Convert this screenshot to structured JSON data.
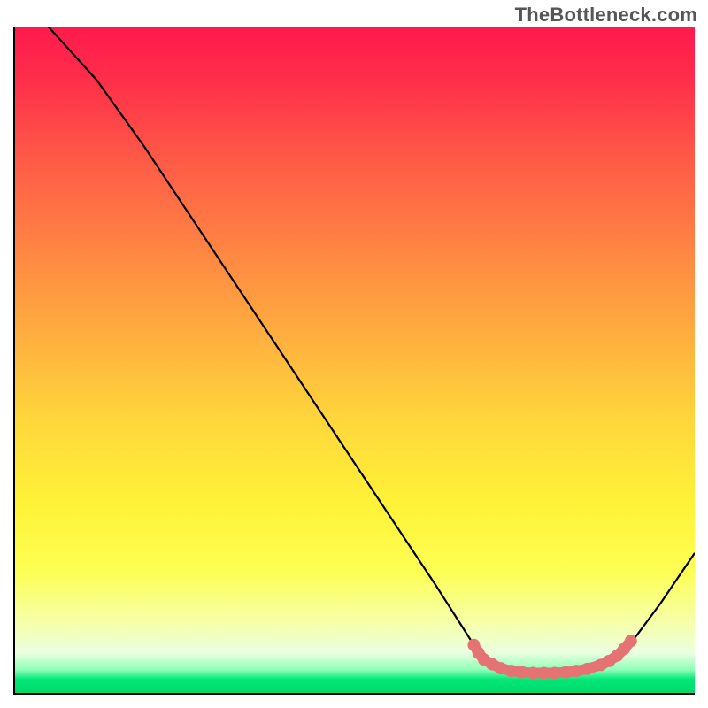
{
  "watermark": "TheBottleneck.com",
  "chart_data": {
    "type": "line",
    "title": "",
    "xlabel": "",
    "ylabel": "",
    "xlim": [
      0,
      100
    ],
    "ylim": [
      0,
      100
    ],
    "curve": [
      {
        "x": 4,
        "y": 101
      },
      {
        "x": 12,
        "y": 92
      },
      {
        "x": 19,
        "y": 82
      },
      {
        "x": 62,
        "y": 16
      },
      {
        "x": 67,
        "y": 8
      },
      {
        "x": 70,
        "y": 4.5
      },
      {
        "x": 73,
        "y": 3.3
      },
      {
        "x": 76,
        "y": 3.0
      },
      {
        "x": 79,
        "y": 3.0
      },
      {
        "x": 82,
        "y": 3.2
      },
      {
        "x": 85,
        "y": 3.8
      },
      {
        "x": 88,
        "y": 5.2
      },
      {
        "x": 91,
        "y": 8.0
      },
      {
        "x": 95,
        "y": 13.5
      },
      {
        "x": 100,
        "y": 21
      }
    ],
    "highlight_points": [
      {
        "x": 67.5,
        "y": 7.2
      },
      {
        "x": 68.2,
        "y": 6.0
      },
      {
        "x": 69.0,
        "y": 5.0
      },
      {
        "x": 70.2,
        "y": 4.3
      },
      {
        "x": 71.5,
        "y": 3.7
      },
      {
        "x": 73.0,
        "y": 3.3
      },
      {
        "x": 74.6,
        "y": 3.1
      },
      {
        "x": 76.2,
        "y": 3.0
      },
      {
        "x": 77.8,
        "y": 3.0
      },
      {
        "x": 79.4,
        "y": 3.0
      },
      {
        "x": 81.0,
        "y": 3.1
      },
      {
        "x": 82.6,
        "y": 3.3
      },
      {
        "x": 84.2,
        "y": 3.6
      },
      {
        "x": 86.2,
        "y": 4.2
      },
      {
        "x": 87.4,
        "y": 4.8
      },
      {
        "x": 88.6,
        "y": 5.6
      },
      {
        "x": 89.6,
        "y": 6.6
      },
      {
        "x": 90.6,
        "y": 7.8
      }
    ],
    "colors": {
      "curve": "#000000",
      "highlight": "#e57373"
    }
  }
}
